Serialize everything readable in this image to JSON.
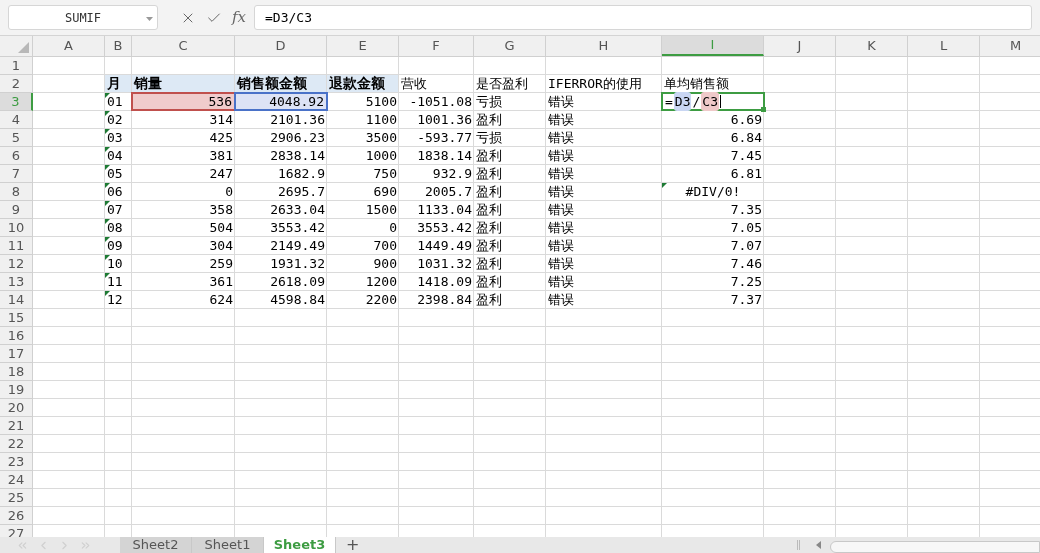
{
  "name_box": {
    "value": "SUMIF"
  },
  "formula_bar": {
    "function_label": "fx",
    "value": "=D3/C3"
  },
  "columns": [
    {
      "label": "A",
      "selected": false
    },
    {
      "label": "B",
      "selected": false
    },
    {
      "label": "C",
      "selected": false
    },
    {
      "label": "D",
      "selected": false
    },
    {
      "label": "E",
      "selected": false
    },
    {
      "label": "F",
      "selected": false
    },
    {
      "label": "G",
      "selected": false
    },
    {
      "label": "H",
      "selected": false
    },
    {
      "label": "I",
      "selected": true
    },
    {
      "label": "J",
      "selected": false
    },
    {
      "label": "K",
      "selected": false
    },
    {
      "label": "L",
      "selected": false
    },
    {
      "label": "M",
      "selected": false
    }
  ],
  "rows": [
    {
      "label": "1",
      "selected": false
    },
    {
      "label": "2",
      "selected": false,
      "cells": [
        {},
        {
          "text": "月",
          "kind": "title"
        },
        {
          "text": "销量",
          "kind": "title"
        },
        {
          "text": "销售额金额",
          "kind": "title"
        },
        {
          "text": "退款金额",
          "kind": "title"
        },
        {
          "text": "营收",
          "kind": "text"
        },
        {
          "text": "是否盈利",
          "kind": "text"
        },
        {
          "text": "IFERROR的使用",
          "kind": "text"
        },
        {
          "text": "单均销售额",
          "kind": "text"
        }
      ]
    },
    {
      "label": "3",
      "selected": true,
      "cells": [
        {},
        {
          "text": "01",
          "kind": "text",
          "flag": true
        },
        {
          "text": "536",
          "kind": "number",
          "color": "#f0cccc"
        },
        {
          "text": "4048.92",
          "kind": "number",
          "color": "#dde3f5"
        },
        {
          "text": "5100",
          "kind": "number"
        },
        {
          "text": "-1051.08",
          "kind": "number"
        },
        {
          "text": "亏损",
          "kind": "text"
        },
        {
          "text": "错误",
          "kind": "text"
        },
        {
          "kind": "editing",
          "parts": [
            {
              "text": "="
            },
            {
              "text": "D3",
              "color": "#c9d6f3"
            },
            {
              "text": "/"
            },
            {
              "text": "C3",
              "color": "#efc9c9"
            }
          ]
        }
      ]
    },
    {
      "label": "4",
      "selected": false,
      "cells": [
        {},
        {
          "text": "02",
          "kind": "text",
          "flag": true
        },
        {
          "text": "314",
          "kind": "number"
        },
        {
          "text": "2101.36",
          "kind": "number"
        },
        {
          "text": "1100",
          "kind": "number"
        },
        {
          "text": "1001.36",
          "kind": "number"
        },
        {
          "text": "盈利",
          "kind": "text"
        },
        {
          "text": "错误",
          "kind": "text"
        },
        {
          "text": "6.69",
          "kind": "number"
        }
      ]
    },
    {
      "label": "5",
      "selected": false,
      "cells": [
        {},
        {
          "text": "03",
          "kind": "text",
          "flag": true
        },
        {
          "text": "425",
          "kind": "number"
        },
        {
          "text": "2906.23",
          "kind": "number"
        },
        {
          "text": "3500",
          "kind": "number"
        },
        {
          "text": "-593.77",
          "kind": "number"
        },
        {
          "text": "亏损",
          "kind": "text"
        },
        {
          "text": "错误",
          "kind": "text"
        },
        {
          "text": "6.84",
          "kind": "number"
        }
      ]
    },
    {
      "label": "6",
      "selected": false,
      "cells": [
        {},
        {
          "text": "04",
          "kind": "text",
          "flag": true
        },
        {
          "text": "381",
          "kind": "number"
        },
        {
          "text": "2838.14",
          "kind": "number"
        },
        {
          "text": "1000",
          "kind": "number"
        },
        {
          "text": "1838.14",
          "kind": "number"
        },
        {
          "text": "盈利",
          "kind": "text"
        },
        {
          "text": "错误",
          "kind": "text"
        },
        {
          "text": "7.45",
          "kind": "number"
        }
      ]
    },
    {
      "label": "7",
      "selected": false,
      "cells": [
        {},
        {
          "text": "05",
          "kind": "text",
          "flag": true
        },
        {
          "text": "247",
          "kind": "number"
        },
        {
          "text": "1682.9",
          "kind": "number"
        },
        {
          "text": "750",
          "kind": "number"
        },
        {
          "text": "932.9",
          "kind": "number"
        },
        {
          "text": "盈利",
          "kind": "text"
        },
        {
          "text": "错误",
          "kind": "text"
        },
        {
          "text": "6.81",
          "kind": "number"
        }
      ]
    },
    {
      "label": "8",
      "selected": false,
      "cells": [
        {},
        {
          "text": "06",
          "kind": "text",
          "flag": true
        },
        {
          "text": "0",
          "kind": "number"
        },
        {
          "text": "2695.7",
          "kind": "number"
        },
        {
          "text": "690",
          "kind": "number"
        },
        {
          "text": "2005.7",
          "kind": "number"
        },
        {
          "text": "盈利",
          "kind": "text"
        },
        {
          "text": "错误",
          "kind": "text"
        },
        {
          "text": "#DIV/0!",
          "kind": "error",
          "flag": true
        }
      ]
    },
    {
      "label": "9",
      "selected": false,
      "cells": [
        {},
        {
          "text": "07",
          "kind": "text",
          "flag": true
        },
        {
          "text": "358",
          "kind": "number"
        },
        {
          "text": "2633.04",
          "kind": "number"
        },
        {
          "text": "1500",
          "kind": "number"
        },
        {
          "text": "1133.04",
          "kind": "number"
        },
        {
          "text": "盈利",
          "kind": "text"
        },
        {
          "text": "错误",
          "kind": "text"
        },
        {
          "text": "7.35",
          "kind": "number"
        }
      ]
    },
    {
      "label": "10",
      "selected": false,
      "cells": [
        {},
        {
          "text": "08",
          "kind": "text",
          "flag": true
        },
        {
          "text": "504",
          "kind": "number"
        },
        {
          "text": "3553.42",
          "kind": "number"
        },
        {
          "text": "0",
          "kind": "number"
        },
        {
          "text": "3553.42",
          "kind": "number"
        },
        {
          "text": "盈利",
          "kind": "text"
        },
        {
          "text": "错误",
          "kind": "text"
        },
        {
          "text": "7.05",
          "kind": "number"
        }
      ]
    },
    {
      "label": "11",
      "selected": false,
      "cells": [
        {},
        {
          "text": "09",
          "kind": "text",
          "flag": true
        },
        {
          "text": "304",
          "kind": "number"
        },
        {
          "text": "2149.49",
          "kind": "number"
        },
        {
          "text": "700",
          "kind": "number"
        },
        {
          "text": "1449.49",
          "kind": "number"
        },
        {
          "text": "盈利",
          "kind": "text"
        },
        {
          "text": "错误",
          "kind": "text"
        },
        {
          "text": "7.07",
          "kind": "number"
        }
      ]
    },
    {
      "label": "12",
      "selected": false,
      "cells": [
        {},
        {
          "text": "10",
          "kind": "text",
          "flag": true
        },
        {
          "text": "259",
          "kind": "number"
        },
        {
          "text": "1931.32",
          "kind": "number"
        },
        {
          "text": "900",
          "kind": "number"
        },
        {
          "text": "1031.32",
          "kind": "number"
        },
        {
          "text": "盈利",
          "kind": "text"
        },
        {
          "text": "错误",
          "kind": "text"
        },
        {
          "text": "7.46",
          "kind": "number"
        }
      ]
    },
    {
      "label": "13",
      "selected": false,
      "cells": [
        {},
        {
          "text": "11",
          "kind": "text",
          "flag": true
        },
        {
          "text": "361",
          "kind": "number"
        },
        {
          "text": "2618.09",
          "kind": "number"
        },
        {
          "text": "1200",
          "kind": "number"
        },
        {
          "text": "1418.09",
          "kind": "number"
        },
        {
          "text": "盈利",
          "kind": "text"
        },
        {
          "text": "错误",
          "kind": "text"
        },
        {
          "text": "7.25",
          "kind": "number"
        }
      ]
    },
    {
      "label": "14",
      "selected": false,
      "cells": [
        {},
        {
          "text": "12",
          "kind": "text",
          "flag": true
        },
        {
          "text": "624",
          "kind": "number"
        },
        {
          "text": "4598.84",
          "kind": "number"
        },
        {
          "text": "2200",
          "kind": "number"
        },
        {
          "text": "2398.84",
          "kind": "number"
        },
        {
          "text": "盈利",
          "kind": "text"
        },
        {
          "text": "错误",
          "kind": "text"
        },
        {
          "text": "7.37",
          "kind": "number"
        }
      ]
    },
    {
      "label": "15",
      "selected": false
    },
    {
      "label": "16",
      "selected": false
    },
    {
      "label": "17",
      "selected": false
    },
    {
      "label": "18",
      "selected": false
    },
    {
      "label": "19",
      "selected": false
    },
    {
      "label": "20",
      "selected": false
    },
    {
      "label": "21",
      "selected": false
    },
    {
      "label": "22",
      "selected": false
    },
    {
      "label": "23",
      "selected": false
    },
    {
      "label": "24",
      "selected": false
    },
    {
      "label": "25",
      "selected": false
    },
    {
      "label": "26",
      "selected": false
    },
    {
      "label": "27",
      "selected": false
    }
  ],
  "sheet_tabs": [
    {
      "label": "Sheet2",
      "selected": false
    },
    {
      "label": "Sheet1",
      "selected": false
    },
    {
      "label": "Sheet3",
      "selected": true
    }
  ],
  "add_sheet": {
    "label": "+"
  }
}
